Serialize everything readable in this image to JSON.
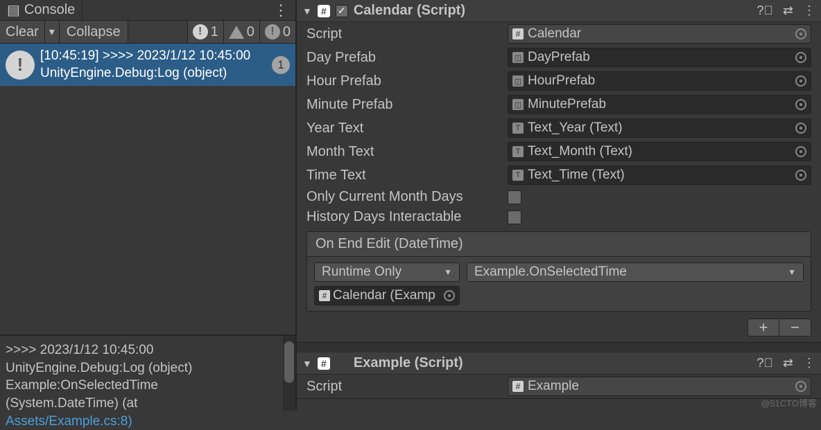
{
  "console": {
    "tab": "Console",
    "clear": "Clear",
    "collapse": "Collapse",
    "counts": {
      "info": "1",
      "warn": "0",
      "error": "0"
    },
    "log": {
      "line1": "[10:45:19] >>>> 2023/1/12 10:45:00",
      "line2": "UnityEngine.Debug:Log (object)",
      "count": "1"
    },
    "detail": {
      "l1": ">>>> 2023/1/12 10:45:00",
      "l2": "UnityEngine.Debug:Log (object)",
      "l3": "Example:OnSelectedTime",
      "l4": "(System.DateTime) (at",
      "l5": "Assets/Example.cs:8)"
    }
  },
  "inspector": {
    "calendar": {
      "title": "Calendar (Script)",
      "script": {
        "label": "Script",
        "value": "Calendar"
      },
      "dayPrefab": {
        "label": "Day Prefab",
        "value": "DayPrefab"
      },
      "hourPrefab": {
        "label": "Hour Prefab",
        "value": "HourPrefab"
      },
      "minutePrefab": {
        "label": "Minute Prefab",
        "value": "MinutePrefab"
      },
      "yearText": {
        "label": "Year Text",
        "value": "Text_Year (Text)"
      },
      "monthText": {
        "label": "Month Text",
        "value": "Text_Month (Text)"
      },
      "timeText": {
        "label": "Time Text",
        "value": "Text_Time (Text)"
      },
      "onlyCurrent": {
        "label": "Only Current Month Days"
      },
      "historyDays": {
        "label": "History Days Interactable"
      },
      "event": {
        "header": "On End Edit (DateTime)",
        "mode": "Runtime Only",
        "method": "Example.OnSelectedTime",
        "target": "Calendar (Examp"
      }
    },
    "example": {
      "title": "Example (Script)",
      "script": {
        "label": "Script",
        "value": "Example"
      }
    }
  },
  "watermark": "@51CTO博客"
}
